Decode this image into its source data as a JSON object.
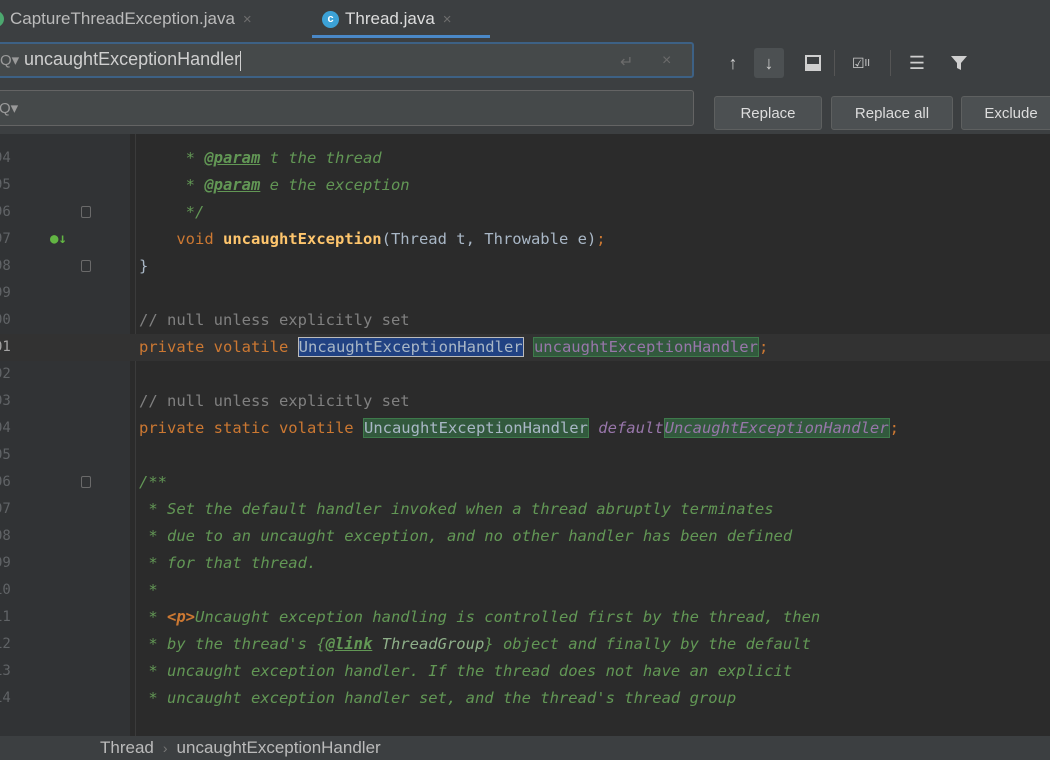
{
  "tabs": [
    {
      "label": "CaptureThreadException.java",
      "close": "×"
    },
    {
      "label": "Thread.java",
      "close": "×",
      "icon_letter": "c"
    }
  ],
  "find": {
    "query": "uncaughtExceptionHandler",
    "replace_value": "",
    "newline_icon": "↵",
    "clear_icon": "×",
    "toolbar_icons": [
      "arrow-up-icon",
      "arrow-down-icon",
      "select-all-occurrences-icon",
      "match-case-icon",
      "filter-lines-icon",
      "filter-icon"
    ],
    "replace_label": "Replace",
    "replace_all_label": "Replace all",
    "exclude_label": "Exclude"
  },
  "editor": {
    "lines": [
      {
        "num": "94",
        "text": "     * @param t the thread"
      },
      {
        "num": "95",
        "text": "     * @param e the exception"
      },
      {
        "num": "96",
        "text": "     */"
      },
      {
        "num": "97",
        "text": "    void uncaughtException(Thread t, Throwable e);"
      },
      {
        "num": "98",
        "text": "}"
      },
      {
        "num": "99",
        "text": ""
      },
      {
        "num": "00",
        "text": "// null unless explicitly set"
      },
      {
        "num": "01",
        "text": "private volatile UncaughtExceptionHandler uncaughtExceptionHandler;"
      },
      {
        "num": "02",
        "text": ""
      },
      {
        "num": "03",
        "text": "// null unless explicitly set"
      },
      {
        "num": "04",
        "text": "private static volatile UncaughtExceptionHandler defaultUncaughtExceptionHandler;"
      },
      {
        "num": "05",
        "text": ""
      },
      {
        "num": "06",
        "text": "/**"
      },
      {
        "num": "07",
        "text": " * Set the default handler invoked when a thread abruptly terminates"
      },
      {
        "num": "08",
        "text": " * due to an uncaught exception, and no other handler has been defined"
      },
      {
        "num": "09",
        "text": " * for that thread."
      },
      {
        "num": "10",
        "text": " *"
      },
      {
        "num": "11",
        "text": " * <p>Uncaught exception handling is controlled first by the thread, then"
      },
      {
        "num": "12",
        "text": " * by the thread's {@link ThreadGroup} object and finally by the default"
      },
      {
        "num": "13",
        "text": " * uncaught exception handler. If the thread does not have an explicit"
      },
      {
        "num": "14",
        "text": " * uncaught exception handler set, and the thread's thread group"
      }
    ],
    "current_line": "01"
  },
  "breadcrumb": {
    "items": [
      "Thread",
      "uncaughtExceptionHandler"
    ],
    "separator": "›"
  },
  "colors": {
    "keyword": "#cc7832",
    "comment": "#808080",
    "doc": "#629755",
    "field": "#9876aa",
    "method": "#ffc66d",
    "match_bg": "#32593d",
    "selected_match_bg": "#214283"
  }
}
